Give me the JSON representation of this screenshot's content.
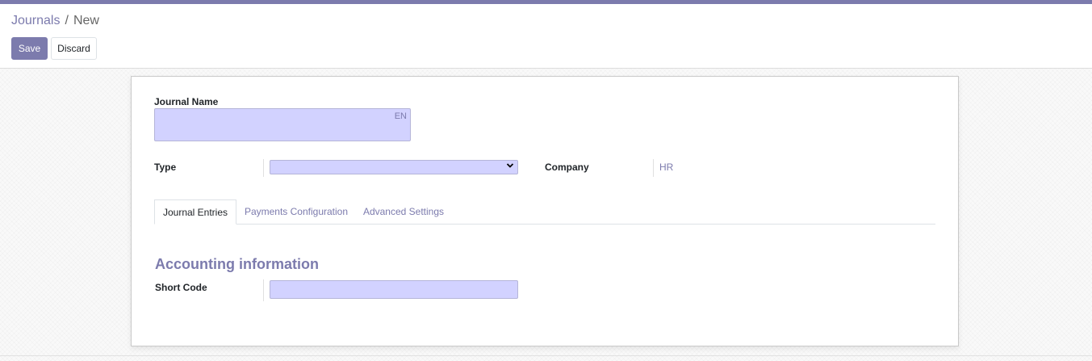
{
  "theme": {
    "accent": "#7c7bad",
    "required_field_bg": "#d2d2ff"
  },
  "breadcrumb": {
    "parent": "Journals",
    "separator": "/",
    "current": "New"
  },
  "toolbar": {
    "save_label": "Save",
    "discard_label": "Discard"
  },
  "form": {
    "journal_name": {
      "label": "Journal Name",
      "value": "",
      "lang": "EN"
    },
    "type": {
      "label": "Type",
      "value": "",
      "icon": "chevron-down-icon"
    },
    "company": {
      "label": "Company",
      "value": "HR"
    },
    "tabs": [
      {
        "label": "Journal Entries",
        "active": true
      },
      {
        "label": "Payments Configuration",
        "active": false
      },
      {
        "label": "Advanced Settings",
        "active": false
      }
    ],
    "section": {
      "title": "Accounting information"
    },
    "short_code": {
      "label": "Short Code",
      "value": ""
    }
  }
}
